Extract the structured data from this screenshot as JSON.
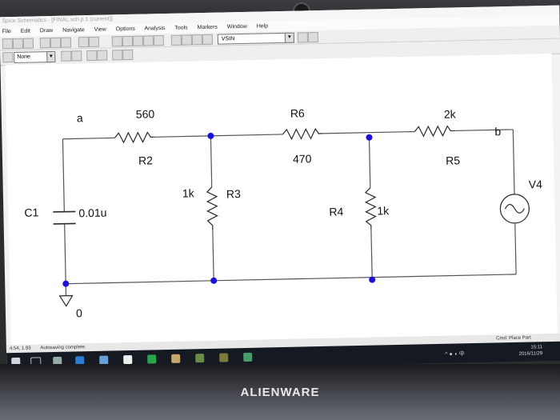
{
  "window": {
    "title": "Spice Schematics - [FINAL.sch p.1 (current)]"
  },
  "menu": [
    "File",
    "Edit",
    "Draw",
    "Navigate",
    "View",
    "Options",
    "Analysis",
    "Tools",
    "Markers",
    "Window",
    "Help"
  ],
  "toolbar": {
    "part_selector": "VSIN",
    "style_selector": "None"
  },
  "schematic": {
    "nodes": {
      "a": "a",
      "b": "b",
      "ground": "0"
    },
    "components": {
      "r2": {
        "name": "R2",
        "value": "560"
      },
      "r6": {
        "name": "R6",
        "value": "470"
      },
      "r5": {
        "name": "R5",
        "value": "2k"
      },
      "r3": {
        "name": "R3",
        "value": "1k"
      },
      "r4": {
        "name": "R4",
        "value": "1k"
      },
      "c1": {
        "name": "C1",
        "value": "0.01u"
      },
      "v4": {
        "name": "V4"
      }
    }
  },
  "status": {
    "coords": "4.54, 1.93",
    "message": "Autosaving complete.",
    "mode": "Cmd: Place Part"
  },
  "taskbar": {
    "time": "15:11",
    "date": "2016/11/29",
    "ime": "中"
  },
  "brand": "ALIENWARE",
  "colors": {
    "wire": "#555555",
    "junction": "#1a10d8",
    "resistor": "#2a2a2a",
    "taskbar": "#151a22"
  }
}
